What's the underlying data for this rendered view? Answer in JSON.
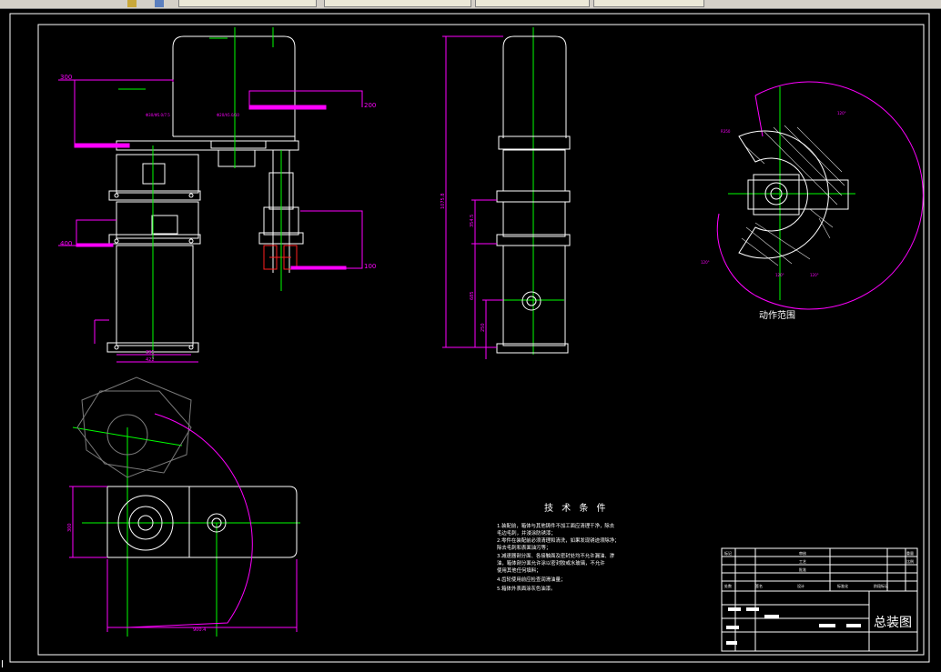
{
  "drawing": {
    "motion_range_label": "动作范围",
    "tech_title": "技 术 条 件",
    "tech_notes": [
      "1.装配前，箱体与其他铸件不加工面应清理干净，除去",
      "  毛边毛刺，并浸涂防锈漆；",
      "2.零件在装配前必须清理和清洗，如果发现锈迹须除净；",
      "  除去毛刺和表面油污等；",
      "3.减速器剖分面、各接触面及密封处均不允许漏油、渗",
      "  油，箱体剖分面允许涂以密封胶或水玻璃，不允许",
      "  使用其他任何填料；",
      "4.齿轮使用前应检查润滑油量；",
      "5.箱体外表面涂灰色油漆。"
    ],
    "title_block_name": "总装图",
    "dims": {
      "d300": "300",
      "d200": "200",
      "d400": "400",
      "d100": "100",
      "d1": "1075.8",
      "d2": "354.5",
      "d3": "685",
      "d4": "250",
      "d5": "300",
      "d6": "900.4",
      "d7": "395",
      "d8": "422",
      "d9": "Φ30/Φ5.0/7.5",
      "d10": "Φ20/h5.0/10",
      "a1": "120°",
      "a2": "120°",
      "a3": "120°",
      "a4": "120°",
      "r1": "R350",
      "r2": "R300"
    },
    "title_block_cells": {
      "c1": "标记",
      "c2": "处数",
      "c3": "签名",
      "c4": "设计",
      "c5": "标准化",
      "c6": "审核",
      "c7": "工艺",
      "c8": "批准",
      "c9": "阶段标记",
      "c10": "重量",
      "c11": "比例"
    }
  }
}
